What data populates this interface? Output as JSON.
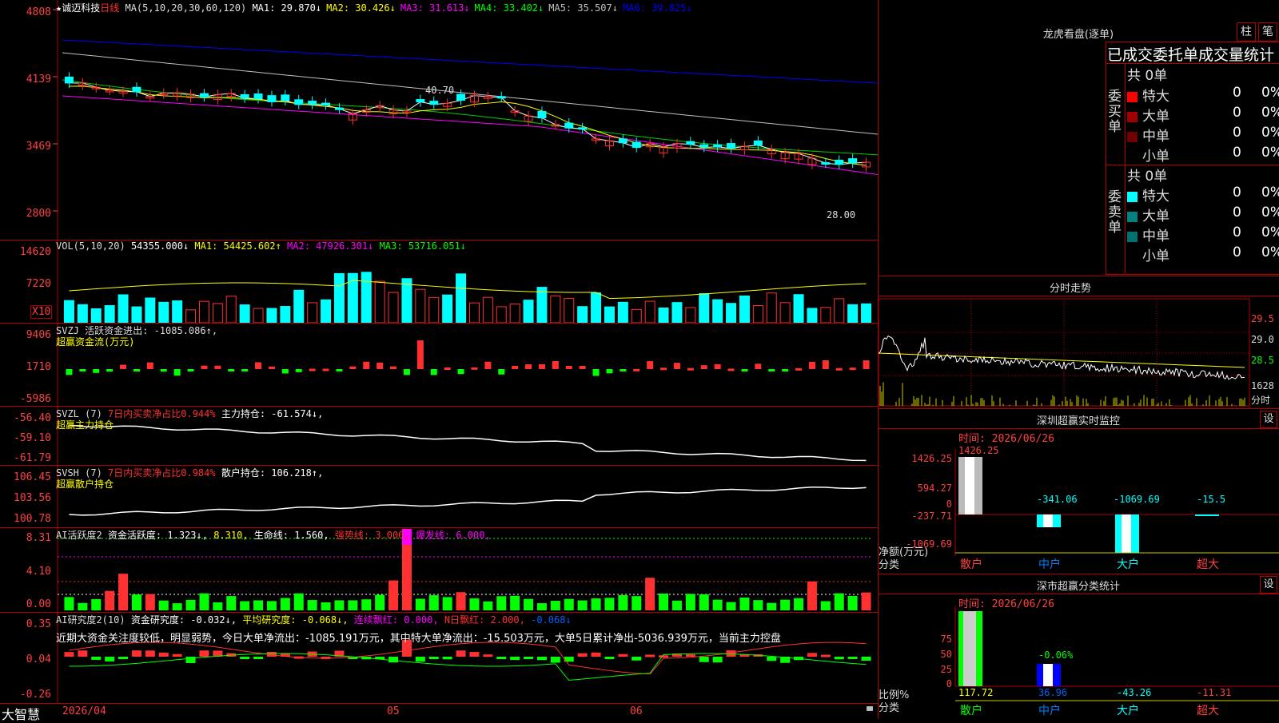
{
  "main": {
    "title_prefix": "★诚迈科技",
    "period": "日线",
    "ma_label": "MA(5,10,20,30,60,120)",
    "ma": [
      {
        "label": "MA1: 29.870↓",
        "color": "#ffffff"
      },
      {
        "label": "MA2: 30.426↓",
        "color": "#ffff00"
      },
      {
        "label": "MA3: 31.613↓",
        "color": "#ff00ff"
      },
      {
        "label": "MA4: 33.402↓",
        "color": "#00ff00"
      },
      {
        "label": "MA5: 35.507↓",
        "color": "#c0c0c0"
      },
      {
        "label": "MA6: 39.825↓",
        "color": "#0000ff"
      }
    ],
    "y_labels": [
      "4808",
      "4139",
      "3469",
      "2800"
    ],
    "high_label": "40.70",
    "low_label": "28.00"
  },
  "volume": {
    "legend": "VOL(5,10,20)",
    "value": "54355.000↓",
    "ma1": "MA1: 54425.602↑",
    "ma2": "MA2: 47926.301↓",
    "ma3": "MA3: 53716.051↓",
    "y_labels": [
      "14620",
      "7220"
    ],
    "unit": "X10"
  },
  "svzj": {
    "legend": "SVZJ  活跃资金进出: -1085.086↑,",
    "sub": "超赢资金流(万元)",
    "y_labels": [
      "9406",
      "1710",
      "-5986"
    ]
  },
  "svzl": {
    "name": "SVZL (7)",
    "desc": "7日内买卖净占比0.944%",
    "value": "主力持仓: -61.574↓,",
    "sub": "超赢主力持仓",
    "y_labels": [
      "-56.40",
      "-59.10",
      "-61.79"
    ]
  },
  "svsh": {
    "name": "SVSH (7)",
    "desc": "7日内买卖净占比0.984%",
    "value": "散户持仓: 106.218↑,",
    "sub": "超赢散户持仓",
    "y_labels": [
      "106.45",
      "103.56",
      "100.78"
    ]
  },
  "ai_active": {
    "name": "AI活跃度2",
    "a": "资金活跃度: 1.323↓,",
    "b": "8.310,",
    "c": "生命线: 1.560,",
    "d": "强势线: 3.000,",
    "e": "爆发线: 6.000,",
    "y_labels": [
      "8.31",
      "4.10",
      "0.00"
    ]
  },
  "ai_research": {
    "name": "AI研究度2(10)",
    "a": "资金研究度: -0.032↓,",
    "b": "平均研究度: -0.068↓,",
    "c": "连续飘红: 0.000,",
    "d": "N日飘红: 2.000,",
    "e": "-0.068↓",
    "text": "近期大资金关注度较低，明显弱势，今日大单净流出：-1085.191万元，其中特大单净流出：-15.503万元，大单5日累计净出-5036.939万元，当前主力控盘",
    "y_labels": [
      "0.35",
      "0.04",
      "-0.26"
    ]
  },
  "bottom": {
    "brand": "大智慧",
    "dates": [
      "2026/04",
      "05",
      "06"
    ]
  },
  "right": {
    "lhb_title": "龙虎看盘(逐单)",
    "btn_zhu": "柱",
    "btn_bi": "笔",
    "stat_title": "已成交委托单成交量统计",
    "buy": {
      "side": "委买单",
      "total": "共 0单",
      "rows": [
        {
          "label": "特大",
          "n": "0",
          "p": "0%",
          "color": "#ff0000"
        },
        {
          "label": "大单",
          "n": "0",
          "p": "0%",
          "color": "#a00000"
        },
        {
          "label": "中单",
          "n": "0",
          "p": "0%",
          "color": "#700000"
        },
        {
          "label": "小单",
          "n": "0",
          "p": "0%",
          "color": ""
        }
      ]
    },
    "sell": {
      "side": "委卖单",
      "total": "共 0单",
      "rows": [
        {
          "label": "特大",
          "n": "0",
          "p": "0%",
          "color": "#00ffff"
        },
        {
          "label": "大单",
          "n": "0",
          "p": "0%",
          "color": "#008080"
        },
        {
          "label": "中单",
          "n": "0",
          "p": "0%",
          "color": "#007070"
        },
        {
          "label": "小单",
          "n": "0",
          "p": "0%",
          "color": ""
        }
      ]
    },
    "intraday": {
      "title": "分时走势",
      "y_labels": [
        "29.5",
        "29.0",
        "28.5"
      ],
      "vol": "1628",
      "vol_lbl": "分时"
    },
    "sz_monitor": {
      "title": "深圳超赢实时监控",
      "btn": "设",
      "time": "时间: 2026/06/26",
      "y_labels": [
        "1426.25",
        "594.27",
        "0",
        "-237.71",
        "-1069.69"
      ],
      "values": [
        "1426.25",
        "-341.06",
        "-1069.69",
        "-15.5"
      ],
      "cats": [
        "散户",
        "中户",
        "大户",
        "超大"
      ],
      "ylabel": "净额(万元)",
      "xlabel": "分类"
    },
    "sz_class": {
      "title": "深市超赢分类统计",
      "btn": "设",
      "time": "时间: 2026/06/26",
      "y_labels": [
        "75",
        "50",
        "25",
        "0"
      ],
      "values": [
        "117.72",
        "36.96",
        "-43.26",
        "-11.31"
      ],
      "mid_label": "-0.06%",
      "cats": [
        "散户",
        "中户",
        "大户",
        "超大"
      ],
      "ylabel": "比例%",
      "xlabel": "分类"
    }
  }
}
